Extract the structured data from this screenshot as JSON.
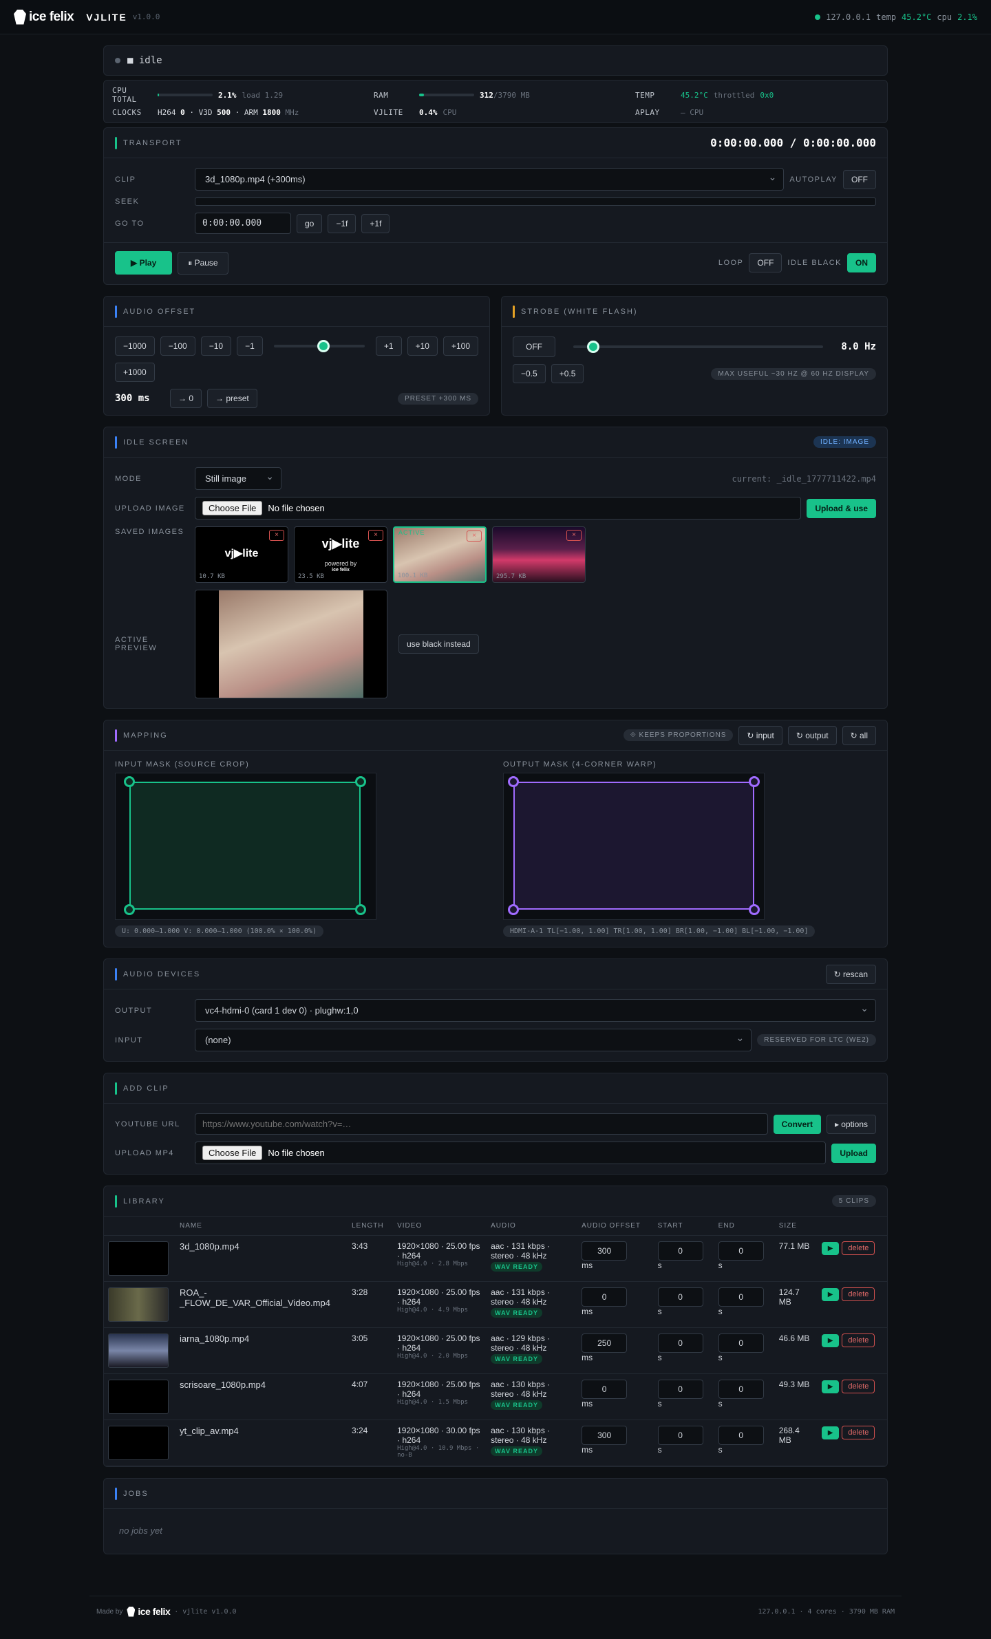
{
  "header": {
    "logo": "ice felix",
    "app_name": "VJLITE",
    "version": "v1.0.0",
    "host": "127.0.0.1",
    "temp_label": "temp",
    "temp": "45.2°C",
    "cpu_label": "cpu",
    "cpu": "2.1%"
  },
  "status": {
    "text": "■ idle"
  },
  "metrics": {
    "cpu_total_label": "CPU TOTAL",
    "cpu_total": "2.1%",
    "cpu_total_pct": 2.1,
    "load": "load 1.29",
    "ram_label": "RAM",
    "ram_used": "312",
    "ram_total": "/3790 MB",
    "ram_pct": 8.2,
    "temp_label": "TEMP",
    "temp": "45.2°C",
    "throttled_label": "throttled",
    "throttled": "0x0",
    "clocks_label": "CLOCKS",
    "clocks_h264_label": "H264",
    "clocks_h264": "0",
    "clocks_v3d_label": "· V3D",
    "clocks_v3d": "500",
    "clocks_arm_label": "· ARM",
    "clocks_arm": "1800",
    "clocks_unit": "MHz",
    "vjlite_label": "VJLITE",
    "vjlite_cpu": "0.4%",
    "vjlite_unit": "CPU",
    "aplay_label": "APLAY",
    "aplay": "— CPU"
  },
  "transport": {
    "title": "TRANSPORT",
    "time": "0:00:00.000 / 0:00:00.000",
    "clip_label": "CLIP",
    "clip_value": "3d_1080p.mp4 (+300ms)",
    "autoplay_label": "AUTOPLAY",
    "autoplay_value": "OFF",
    "seek_label": "SEEK",
    "goto_label": "GO TO",
    "goto_value": "0:00:00.000",
    "go": "go",
    "minus1f": "−1f",
    "plus1f": "+1f",
    "play": "▶ Play",
    "pause": "⏸ Pause",
    "loop_label": "LOOP",
    "loop_value": "OFF",
    "idle_black_label": "IDLE BLACK",
    "idle_black_value": "ON"
  },
  "audio_offset": {
    "title": "AUDIO OFFSET",
    "buttons_minus": [
      "−1000",
      "−100",
      "−10",
      "−1"
    ],
    "buttons_plus": [
      "+1",
      "+10",
      "+100"
    ],
    "btn_plus1000": "+1000",
    "value": "300 ms",
    "to_zero": "→ 0",
    "to_preset": "→ preset",
    "preset_pill": "PRESET +300 MS",
    "slider_fraction": 0.55
  },
  "strobe": {
    "title": "STROBE (WHITE FLASH)",
    "toggle": "OFF",
    "hz": "8.0 Hz",
    "minus": "−0.5",
    "plus": "+0.5",
    "pill": "MAX USEFUL ~30 HZ @ 60 HZ DISPLAY",
    "slider_fraction": 0.08
  },
  "idle": {
    "title": "IDLE SCREEN",
    "pill": "IDLE: IMAGE",
    "mode_label": "MODE",
    "mode_value": "Still image",
    "current": "current: _idle_1777711422.mp4",
    "upload_label": "UPLOAD IMAGE",
    "choose": "Choose File",
    "no_file": "No file chosen",
    "upload_btn": "Upload & use",
    "saved_label": "SAVED IMAGES",
    "thumbs": [
      {
        "size": "10.7 KB",
        "x": "×",
        "text": "vj▶lite"
      },
      {
        "size": "23.5 KB",
        "x": "×",
        "text": "vj▶lite",
        "sub": "powered by",
        "sub2": "ice felix"
      },
      {
        "size": "100.1 KB",
        "x": "×",
        "active": "ACTIVE"
      },
      {
        "size": "295.7 KB",
        "x": "×"
      }
    ],
    "preview_label": "ACTIVE PREVIEW",
    "black_btn": "use black instead"
  },
  "mapping": {
    "title": "MAPPING",
    "pill": "⟐ KEEPS PROPORTIONS",
    "btn_input": "↻ input",
    "btn_output": "↻ output",
    "btn_all": "↻ all",
    "input_title": "INPUT MASK (SOURCE CROP)",
    "output_title": "OUTPUT MASK (4-CORNER WARP)",
    "input_info": "U: 0.000–1.000  V: 0.000–1.000  (100.0% × 100.0%)",
    "output_info": "HDMI-A-1  TL[−1.00, 1.00]  TR[1.00, 1.00]  BR[1.00, −1.00]  BL[−1.00, −1.00]"
  },
  "audio_devices": {
    "title": "AUDIO DEVICES",
    "rescan": "↻ rescan",
    "output_label": "OUTPUT",
    "output_value": "vc4-hdmi-0 (card 1 dev 0) · plughw:1,0",
    "input_label": "INPUT",
    "input_value": "(none)",
    "reserved": "RESERVED FOR LTC (WE2)"
  },
  "add_clip": {
    "title": "ADD CLIP",
    "yt_label": "YOUTUBE URL",
    "yt_placeholder": "https://www.youtube.com/watch?v=…",
    "convert": "Convert",
    "options": "▸ options",
    "upload_label": "UPLOAD MP4",
    "choose": "Choose File",
    "no_file": "No file chosen",
    "upload": "Upload"
  },
  "library": {
    "title": "LIBRARY",
    "count": "5 CLIPS",
    "headers": [
      "NAME",
      "LENGTH",
      "VIDEO",
      "AUDIO",
      "AUDIO OFFSET",
      "START",
      "END",
      "SIZE"
    ],
    "rows": [
      {
        "name": "3d_1080p.mp4",
        "length": "3:43",
        "video": "1920×1080 · 25.00 fps · h264",
        "vsub": "High@4.0 · 2.8 Mbps",
        "audio": "aac · 131 kbps · stereo · 48 kHz",
        "wav": "WAV READY",
        "offset": "300",
        "start": "0",
        "end": "0",
        "size": "77.1 MB"
      },
      {
        "name": "ROA_-_FLOW_DE_VAR_Official_Video.mp4",
        "length": "3:28",
        "video": "1920×1080 · 25.00 fps · h264",
        "vsub": "High@4.0 · 4.9 Mbps",
        "audio": "aac · 131 kbps · stereo · 48 kHz",
        "wav": "WAV READY",
        "offset": "0",
        "start": "0",
        "end": "0",
        "size": "124.7 MB"
      },
      {
        "name": "iarna_1080p.mp4",
        "length": "3:05",
        "video": "1920×1080 · 25.00 fps · h264",
        "vsub": "High@4.0 · 2.0 Mbps",
        "audio": "aac · 129 kbps · stereo · 48 kHz",
        "wav": "WAV READY",
        "offset": "250",
        "start": "0",
        "end": "0",
        "size": "46.6 MB"
      },
      {
        "name": "scrisoare_1080p.mp4",
        "length": "4:07",
        "video": "1920×1080 · 25.00 fps · h264",
        "vsub": "High@4.0 · 1.5 Mbps",
        "audio": "aac · 130 kbps · stereo · 48 kHz",
        "wav": "WAV READY",
        "offset": "0",
        "start": "0",
        "end": "0",
        "size": "49.3 MB"
      },
      {
        "name": "yt_clip_av.mp4",
        "length": "3:24",
        "video": "1920×1080 · 30.00 fps · h264",
        "vsub": "High@4.0 · 10.9 Mbps · no-B",
        "audio": "aac · 130 kbps · stereo · 48 kHz",
        "wav": "WAV READY",
        "offset": "300",
        "start": "0",
        "end": "0",
        "size": "268.4 MB"
      }
    ],
    "ms": "ms",
    "s": "s",
    "play": "▶",
    "delete": "delete"
  },
  "jobs": {
    "title": "JOBS",
    "empty": "no jobs yet"
  },
  "footer": {
    "made_by": "Made by",
    "logo": "ice felix",
    "version": "· vjlite v1.0.0",
    "right": "127.0.0.1 · 4 cores · 3790 MB RAM"
  }
}
